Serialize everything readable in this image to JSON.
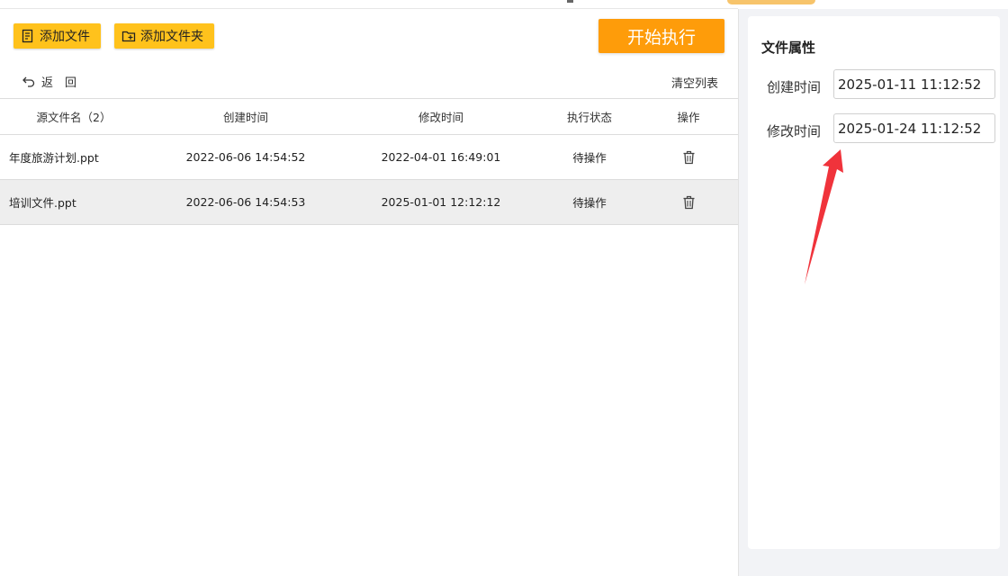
{
  "toolbar": {
    "add_file": "添加文件",
    "add_folder": "添加文件夹",
    "start": "开始执行"
  },
  "nav": {
    "back": "返回",
    "clear": "清空列表"
  },
  "table": {
    "headers": {
      "name": "源文件名（2）",
      "created": "创建时间",
      "modified": "修改时间",
      "state": "执行状态",
      "op": "操作"
    },
    "rows": [
      {
        "name": "年度旅游计划.ppt",
        "created": "2022-06-06 14:54:52",
        "modified": "2022-04-01 16:49:01",
        "state": "待操作"
      },
      {
        "name": "培训文件.ppt",
        "created": "2022-06-06 14:54:53",
        "modified": "2025-01-01 12:12:12",
        "state": "待操作"
      }
    ]
  },
  "properties": {
    "title": "文件属性",
    "created_label": "创建时间",
    "created_value": "2025-01-11 11:12:52",
    "modified_label": "修改时间",
    "modified_value": "2025-01-24 11:12:52"
  },
  "colors": {
    "button": "#ffc21c",
    "start_button": "#fe9c0a",
    "arrow": "#f0333b",
    "selected_row": "#eeeeee"
  }
}
